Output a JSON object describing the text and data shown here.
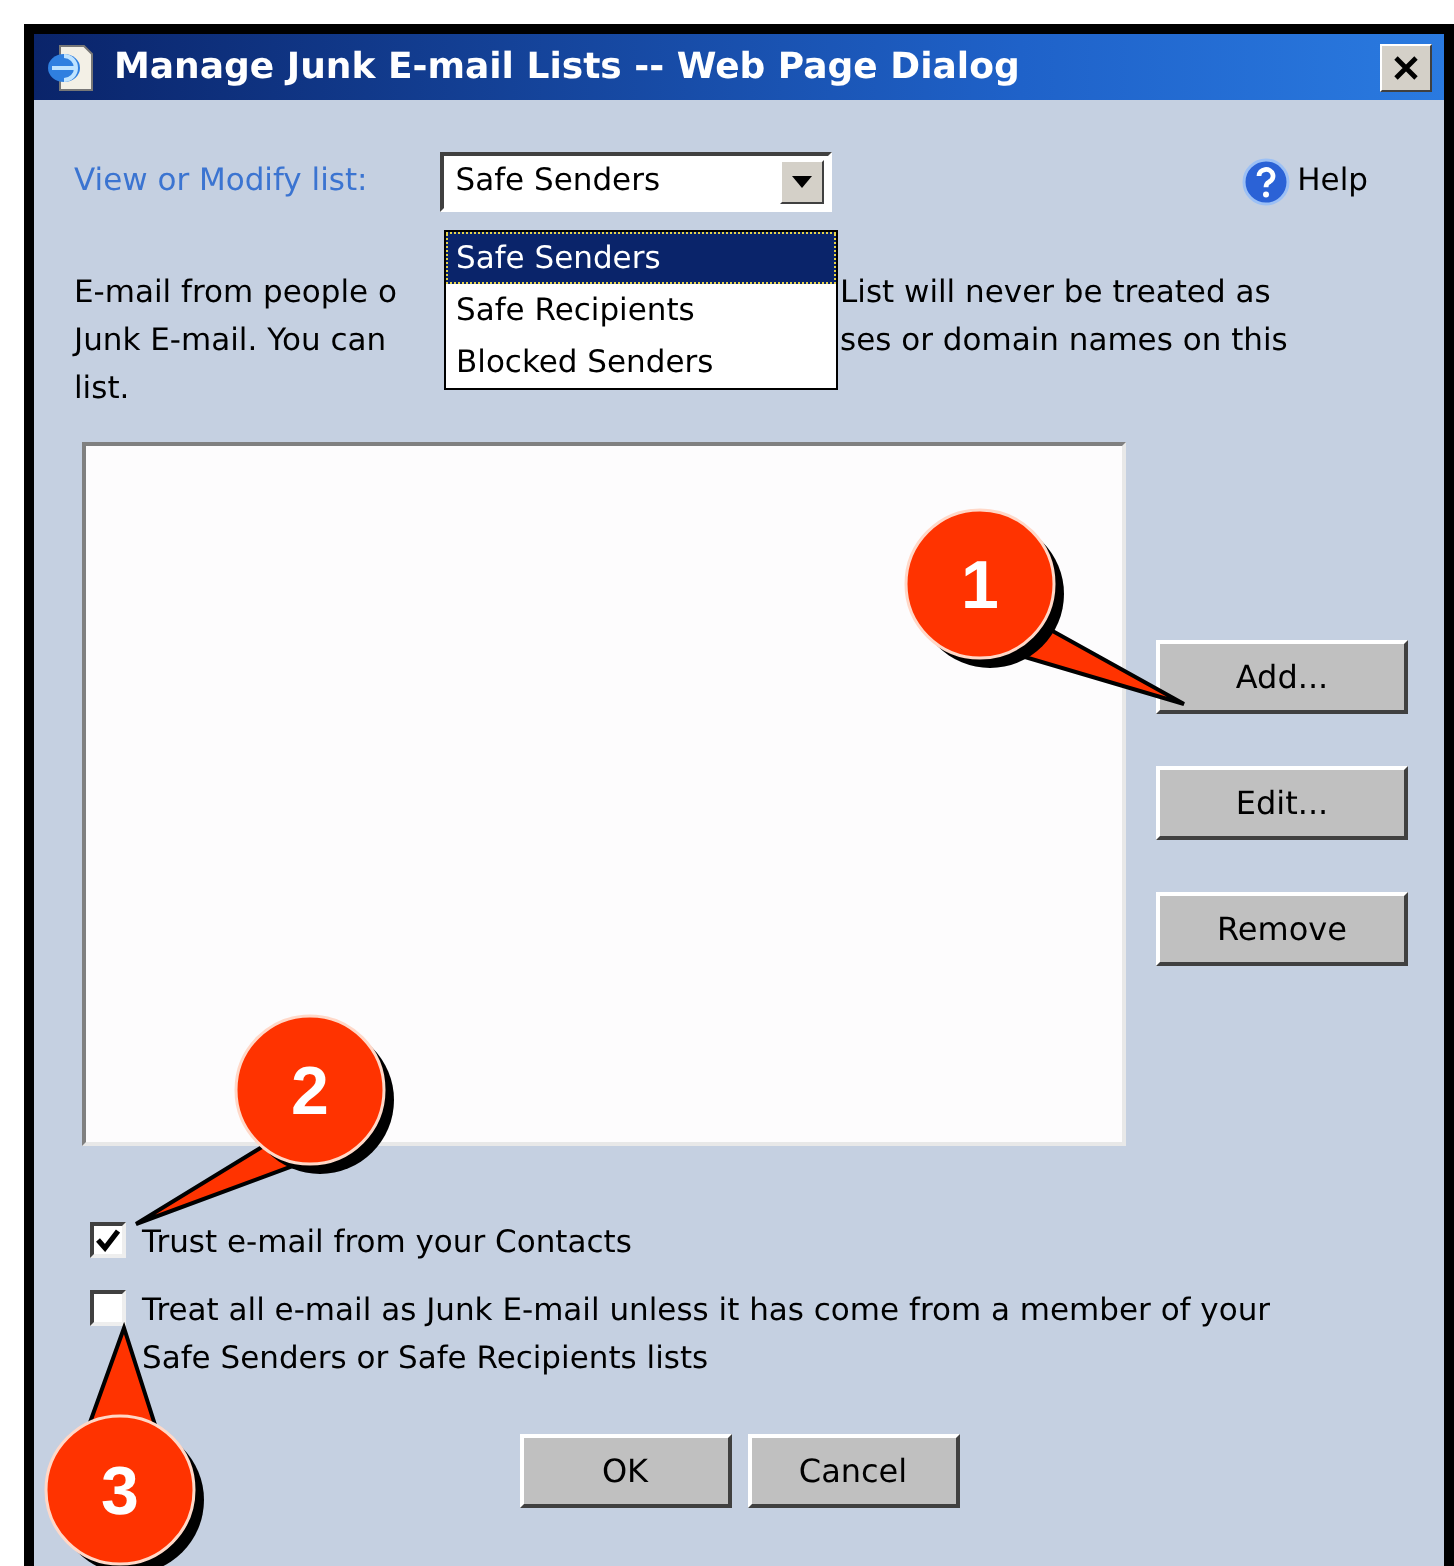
{
  "window": {
    "title": "Manage Junk E-mail Lists -- Web Page Dialog"
  },
  "list_selector": {
    "label": "View or Modify list:",
    "value": "Safe Senders",
    "expanded": true,
    "options": [
      {
        "label": "Safe Senders",
        "selected": true
      },
      {
        "label": "Safe Recipients",
        "selected": false
      },
      {
        "label": "Blocked Senders",
        "selected": false
      }
    ]
  },
  "help": {
    "label": "Help"
  },
  "description_lines": [
    {
      "left": "E-mail from people o",
      "right": "List will never be treated as"
    },
    {
      "left": "Junk E-mail. You can",
      "right": "ses or domain names on this"
    },
    {
      "left": "list."
    }
  ],
  "buttons": [
    "Add...",
    "Edit...",
    "Remove"
  ],
  "options": [
    {
      "label": "Trust e-mail from your Contacts",
      "checked": true
    },
    {
      "label": "Treat all e-mail as Junk E-mail unless it has come from a member of your Safe Senders or Safe Recipients lists",
      "checked": false
    }
  ],
  "footer_buttons": [
    "OK",
    "Cancel"
  ],
  "callouts": [
    {
      "number": "1"
    },
    {
      "number": "2"
    },
    {
      "number": "3"
    }
  ]
}
